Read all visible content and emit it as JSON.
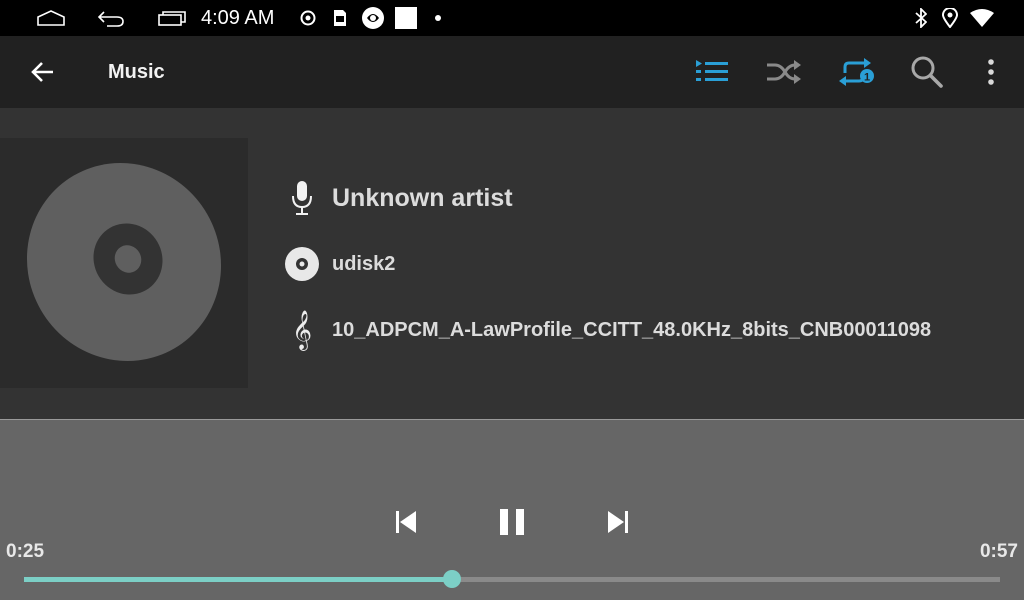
{
  "status_bar": {
    "time": "4:09 AM",
    "icons": [
      "home-icon",
      "back-icon",
      "recents-icon",
      "record-icon",
      "sd-card-icon",
      "app-icon",
      "white-square-icon",
      "dot-icon",
      "bluetooth-icon",
      "location-icon",
      "wifi-icon"
    ]
  },
  "toolbar": {
    "title": "Music",
    "accent_color": "#2a9fd6",
    "icons": [
      "back-arrow-icon",
      "playlist-icon",
      "shuffle-icon",
      "repeat-one-icon",
      "search-icon",
      "more-vert-icon"
    ]
  },
  "track": {
    "artist": "Unknown artist",
    "album": "udisk2",
    "title": "10_ADPCM_A-LawProfile_CCITT_48.0KHz_8bits_CNB00011098"
  },
  "playback": {
    "elapsed": "0:25",
    "duration": "0:57",
    "progress": 0.4386,
    "accent_color": "#7ccfc6",
    "state": "playing"
  }
}
